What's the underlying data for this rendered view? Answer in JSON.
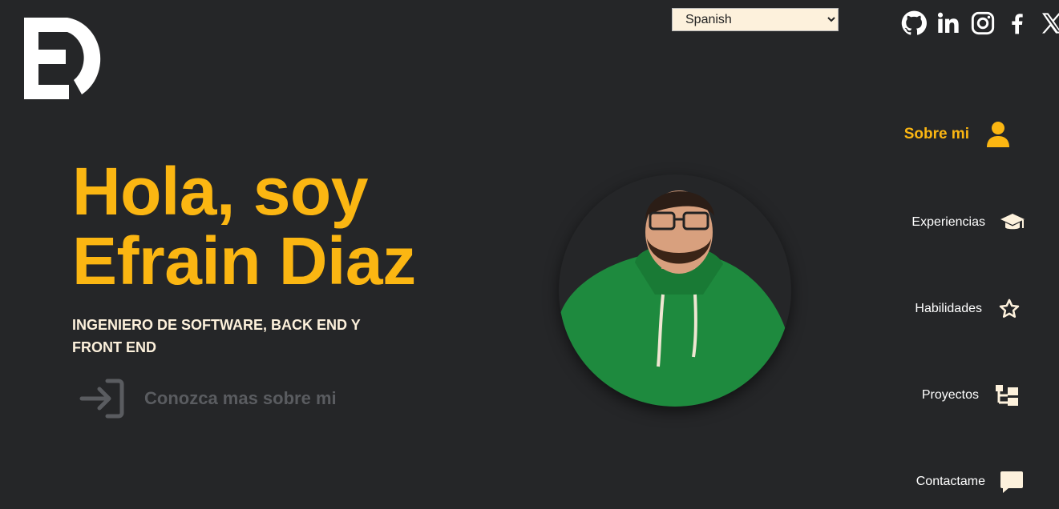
{
  "language_selector": {
    "selected": "Spanish"
  },
  "social": [
    {
      "name": "github-icon"
    },
    {
      "name": "linkedin-icon"
    },
    {
      "name": "instagram-icon"
    },
    {
      "name": "facebook-icon"
    },
    {
      "name": "x-icon"
    }
  ],
  "hero": {
    "title_line1": "Hola, soy",
    "title_line2": "Efrain Diaz",
    "subtitle": "INGENIERO DE SOFTWARE, BACK END Y FRONT END",
    "cta_label": "Conozca mas sobre mi"
  },
  "nav": {
    "items": [
      {
        "label": "Sobre mi",
        "icon": "user-icon",
        "active": true
      },
      {
        "label": "Experiencias",
        "icon": "graduation-cap-icon",
        "active": false
      },
      {
        "label": "Habilidades",
        "icon": "star-icon",
        "active": false
      },
      {
        "label": "Proyectos",
        "icon": "project-tree-icon",
        "active": false
      },
      {
        "label": "Contactame",
        "icon": "chat-bubble-icon",
        "active": false
      }
    ]
  },
  "colors": {
    "background": "#252628",
    "accent": "#fbb612",
    "cream": "#fdf1dc",
    "muted": "#5a5c60",
    "hoodie": "#1e8a3e"
  }
}
